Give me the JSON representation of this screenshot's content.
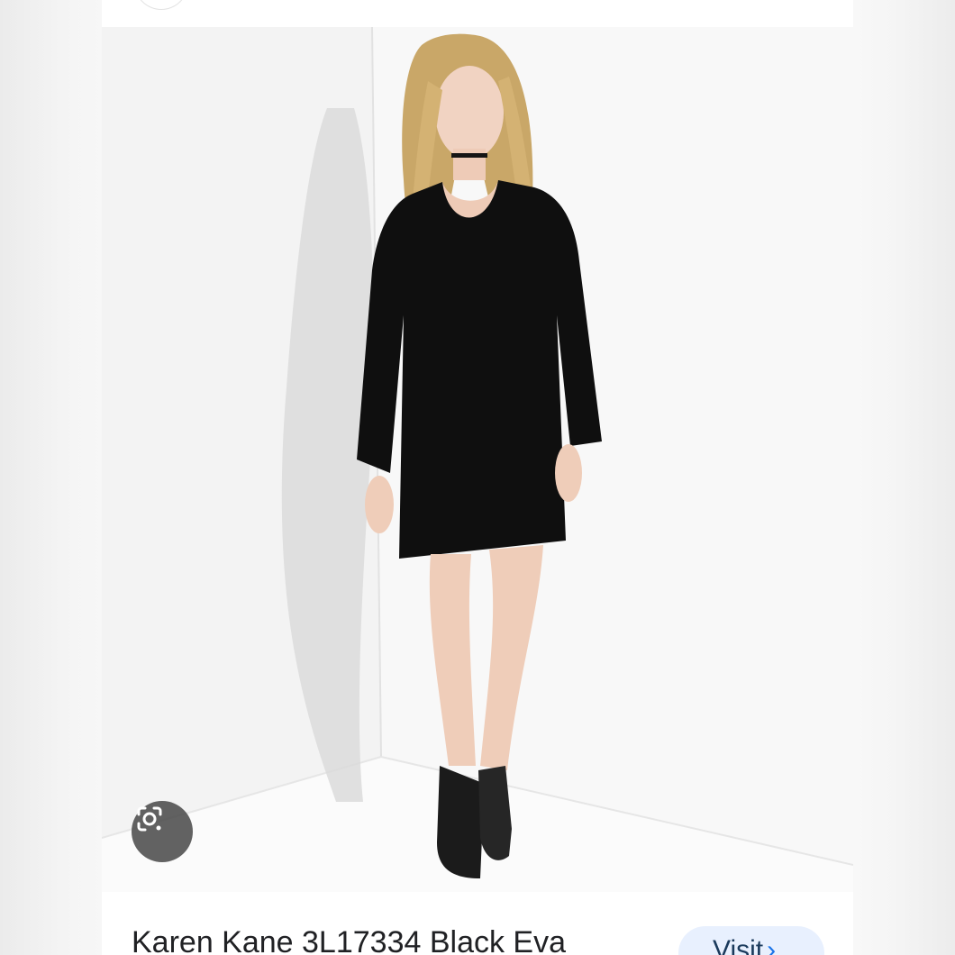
{
  "product": {
    "title": "Karen Kane 3L17334 Black Eva",
    "visit_label": "Visit",
    "visit_arrow": "›"
  },
  "icons": {
    "lens": "google-lens-icon"
  },
  "colors": {
    "card_background": "#ffffff",
    "visit_button_background": "#e8f0fe",
    "lens_button_background": "#464646"
  }
}
